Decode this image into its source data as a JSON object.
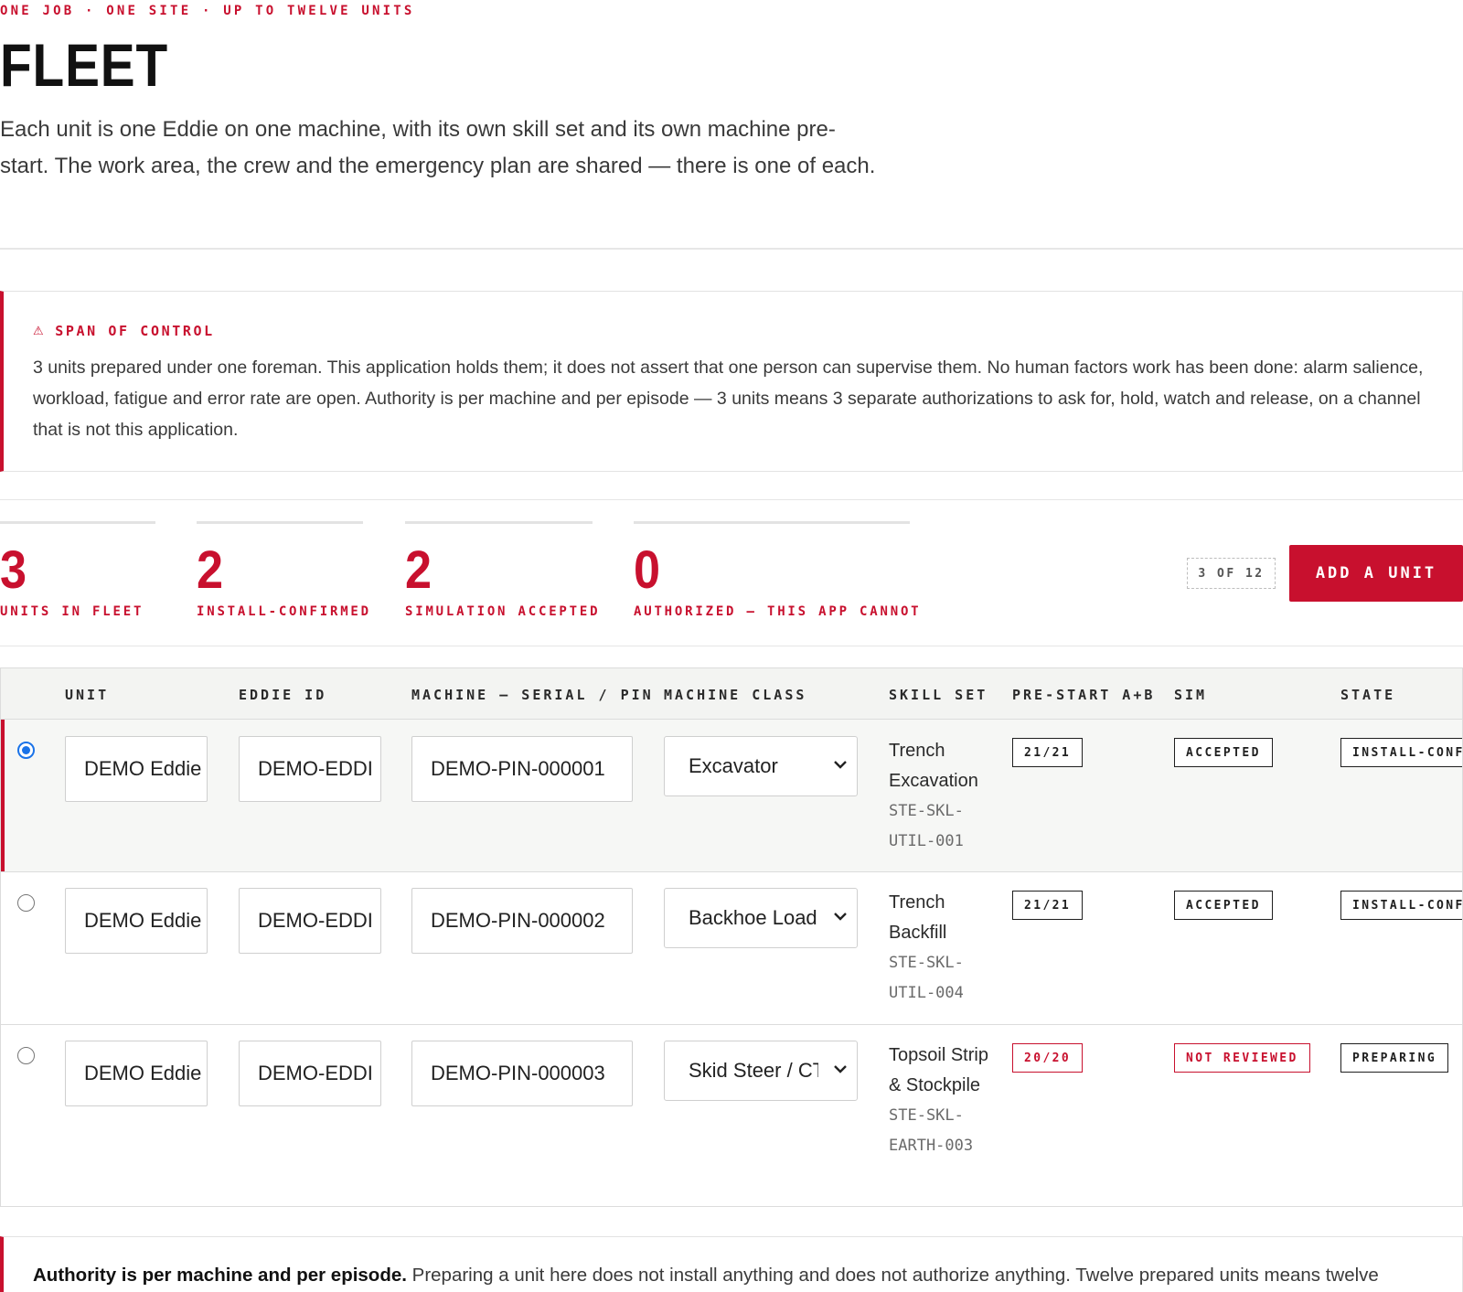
{
  "header": {
    "eyebrow": "ONE JOB · ONE SITE · UP TO TWELVE UNITS",
    "title": "FLEET",
    "intro": "Each unit is one Eddie on one machine, with its own skill set and its own machine pre-start. The work area, the crew and the emergency plan are shared — there is one of each."
  },
  "callout": {
    "icon": "warning-icon",
    "icon_glyph": "⚠",
    "heading": "SPAN OF CONTROL",
    "body": "3 units prepared under one foreman. This application holds them; it does not assert that one person can supervise them. No human factors work has been done: alarm salience, workload, fatigue and error rate are open. Authority is per machine and per episode — 3 units means 3 separate authorizations to ask for, hold, watch and release, on a channel that is not this application."
  },
  "stats": [
    {
      "value": "3",
      "label": "UNITS IN FLEET"
    },
    {
      "value": "2",
      "label": "INSTALL-CONFIRMED"
    },
    {
      "value": "2",
      "label": "SIMULATION ACCEPTED"
    },
    {
      "value": "0",
      "label": "AUTHORIZED — THIS APP CANNOT"
    }
  ],
  "capacity": "3 OF 12",
  "add_button": "ADD A UNIT",
  "table": {
    "headers": {
      "unit": "UNIT",
      "eddie_id": "EDDIE ID",
      "machine": "MACHINE — SERIAL / PIN",
      "machine_class": "MACHINE CLASS",
      "skill_set": "SKILL SET",
      "prestart": "PRE-START A+B",
      "sim": "SIM",
      "state": "STATE"
    },
    "rows": [
      {
        "selected": true,
        "unit": "DEMO Eddie",
        "eddie_id": "DEMO-EDDI",
        "machine": "DEMO-PIN-000001",
        "machine_class": "Excavator",
        "skill_name": "Trench Excavation",
        "skill_code": "STE-SKL-UTIL-001",
        "prestart": "21/21",
        "sim": "ACCEPTED",
        "state": "INSTALL-CONF"
      },
      {
        "selected": false,
        "unit": "DEMO Eddie",
        "eddie_id": "DEMO-EDDI",
        "machine": "DEMO-PIN-000002",
        "machine_class": "Backhoe Load",
        "skill_name": "Trench Backfill",
        "skill_code": "STE-SKL-UTIL-004",
        "prestart": "21/21",
        "sim": "ACCEPTED",
        "state": "INSTALL-CONF"
      },
      {
        "selected": false,
        "unit": "DEMO Eddie",
        "eddie_id": "DEMO-EDDI",
        "machine": "DEMO-PIN-000003",
        "machine_class": "Skid Steer / CT",
        "skill_name": "Topsoil Strip & Stockpile",
        "skill_code": "STE-SKL-EARTH-003",
        "prestart": "20/20",
        "sim": "NOT REVIEWED",
        "state": "PREPARING"
      }
    ]
  },
  "footer": {
    "bold": "Authority is per machine and per episode.",
    "text": " Preparing a unit here does not install anything and does not authorize anything. Twelve prepared units means twelve"
  },
  "colors": {
    "accent": "#c8102e",
    "radio": "#1a73e8"
  }
}
